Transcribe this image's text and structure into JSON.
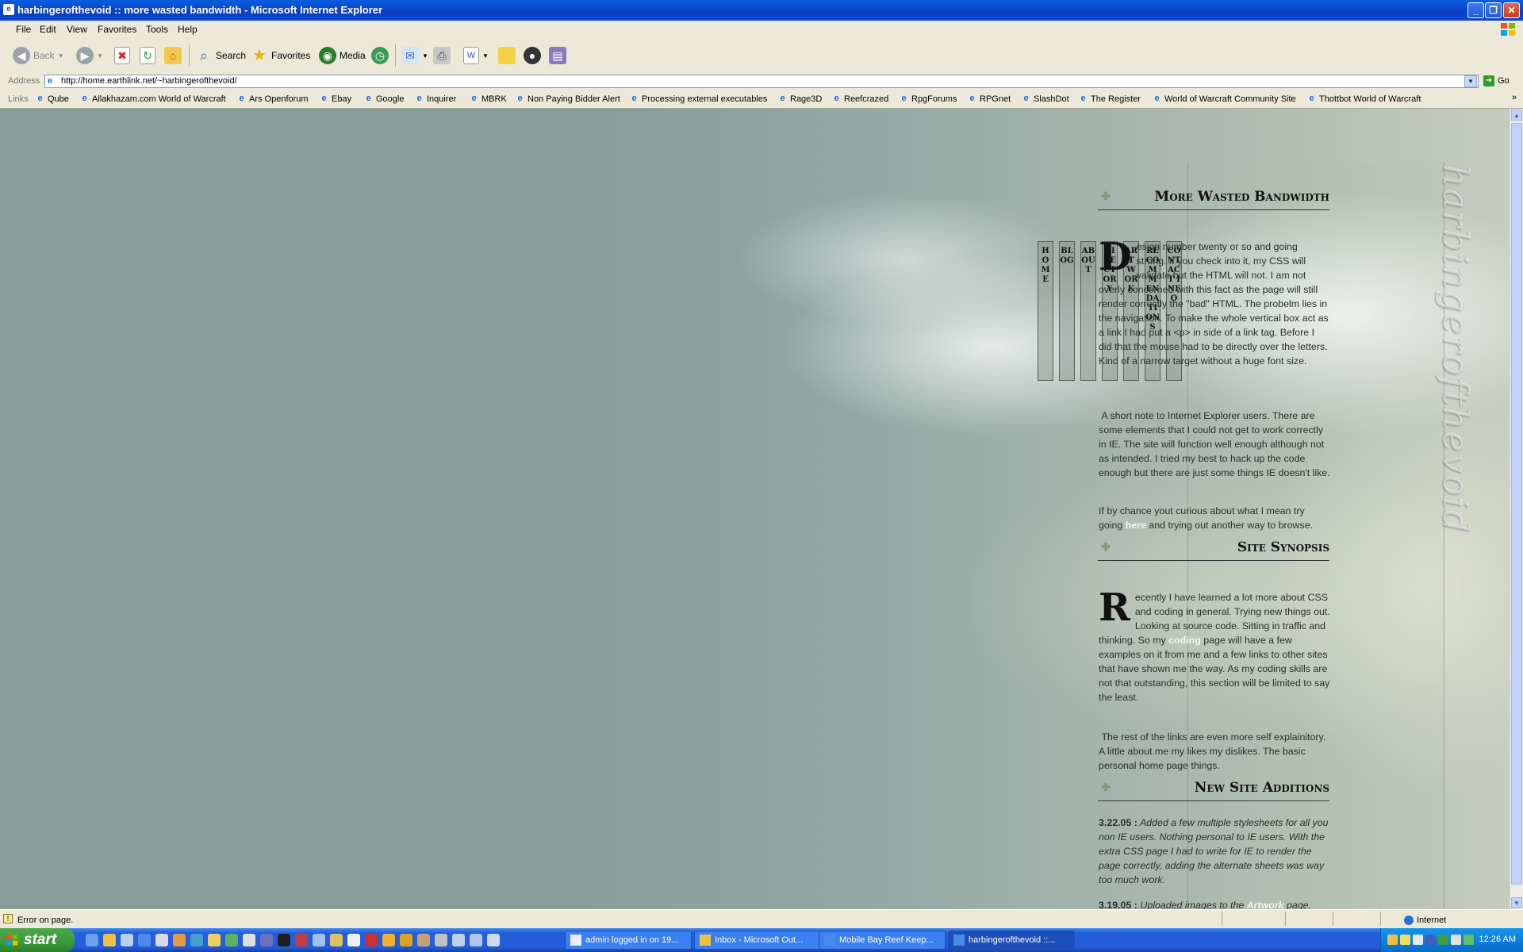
{
  "window": {
    "title": "harbingerofthevoid :: more wasted bandwidth - Microsoft Internet Explorer",
    "controls": [
      "minimize",
      "maximize",
      "close"
    ]
  },
  "menu": [
    "File",
    "Edit",
    "View",
    "Favorites",
    "Tools",
    "Help"
  ],
  "toolbar": {
    "back_label": "Back",
    "search_label": "Search",
    "favorites_label": "Favorites",
    "media_label": "Media"
  },
  "address": {
    "label": "Address",
    "url": "http://home.earthlink.net/~harbingerofthevoid/",
    "go_label": "Go"
  },
  "links": {
    "label": "Links",
    "items": [
      "Qube",
      "Allakhazam.com World of Warcraft",
      "Ars Openforum",
      "Ebay",
      "Google",
      "Inquirer",
      "MBRK",
      "Non Paying Bidder Alert",
      "Processing external executables",
      "Rage3D",
      "Reefcrazed",
      "RpgForums",
      "RPGnet",
      "SlashDot",
      "The Register",
      "World of Warcraft Community Site",
      "Thottbot World of Warcraft"
    ],
    "more": "»"
  },
  "page": {
    "logo_text": "harbingerofthevoid",
    "nav": [
      "HOME",
      "BLOG",
      "ABOUT",
      "DIRECTORY",
      "ARTWORK",
      "RECOMMENDATIONS",
      "CONTACT INFO"
    ],
    "sections": {
      "wasted": {
        "title": "More Wasted Bandwidth",
        "dropcap": "D",
        "p1": "esign number twenty or so and going strong. If you check into it, my CSS will validate but the HTML will not. I am not overly concerned with this fact as the page will still render correctly the \"bad\" HTML. The probelm lies in the navigation. To make the whole vertical box act as a link I had put a <p> in side of a link tag. Before I did that the mouse had to be directly over the letters. Kind of a narrow target without a huge font size.",
        "p2": "A short note to Internet Explorer users. There are some elements that I could not get to work correctly in IE. The site will function well enough although not as intended. I tried my best to hack up the code enough but there are just some things IE doesn't like.",
        "p3_before": "If by chance yout curious about what I mean try going ",
        "p3_link": "here",
        "p3_after": " and trying out another way to browse."
      },
      "synopsis": {
        "title": "Site Synopsis",
        "dropcap": "R",
        "p1_before": "ecently I have learned a lot more about CSS and coding in general. Trying new things out. Looking at source code. Sitting in traffic and thinking. So my ",
        "p1_link": "coding",
        "p1_after": " page will have a few examples on it from me and a few links to other sites that have shown me the way. As my coding skills are not that outstanding, this section will be limited to say the least.",
        "p2": "The rest of the links are even more self explainitory. A little about me my likes my dislikes. The basic personal home page things."
      },
      "additions": {
        "title": "New Site Additions",
        "entry1_date": "3.22.05 :",
        "entry1_text": "Added a few multiple stylesheets for all you non IE users. Nothing personal to IE users. With the extra CSS page I had to write for IE to render the page correctly, adding the alternate sheets was way too much work.",
        "entry2_date": "3.19.05 :",
        "entry2_before": "Uploaded images to the ",
        "entry2_link": "Artwork",
        "entry2_after": " page."
      }
    }
  },
  "status": {
    "text": "Error on page.",
    "zone": "Internet"
  },
  "taskbar": {
    "start_label": "start",
    "tasks": [
      "admin logged in on 19...",
      "Inbox - Microsoft Out...",
      "Mobile Bay Reef Keep...",
      "harbingerofthevoid ::..."
    ],
    "clock": "12:26 AM"
  },
  "colors": {
    "titlebar": "#0a4fd0",
    "chrome": "#ece9d8",
    "page_bg": "#869e99",
    "link_highlight": "#f4f6f0",
    "taskbar": "#245edb",
    "start_button": "#3c9a3a"
  }
}
